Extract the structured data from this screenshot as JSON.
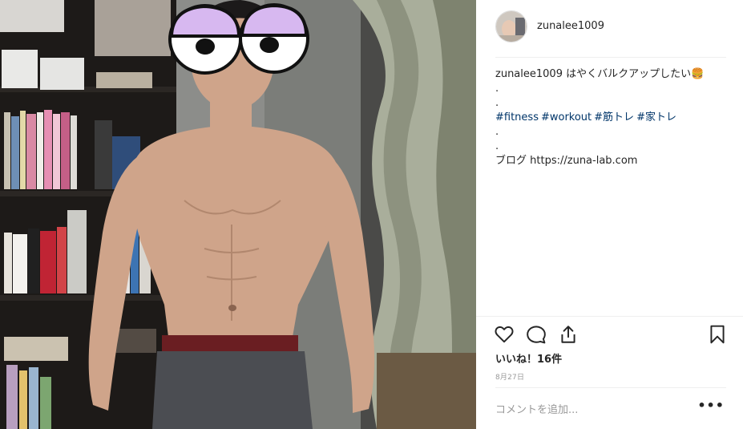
{
  "post": {
    "image_alt": "post-photo",
    "author": "zunalee1009"
  },
  "caption": {
    "username": "zunalee1009",
    "text": " はやくバルクアップしたい🍔",
    "dot1": ".",
    "dot2": ".",
    "hashtags": [
      "#fitness",
      "#workout",
      "#筋トレ",
      "#家トレ"
    ],
    "dot3": ".",
    "dot4": ".",
    "blog_label": "ブログ",
    "blog_url": "https://zuna-lab.com"
  },
  "actions": {
    "like_icon": "heart-icon",
    "comment_icon": "comment-icon",
    "share_icon": "share-icon",
    "save_icon": "bookmark-icon"
  },
  "likes": "いいね！16件",
  "date": "8月27日",
  "comment": {
    "placeholder": "コメントを追加...",
    "more_label": "•••"
  },
  "colors": {
    "text": "#262626",
    "hashtag": "#003569",
    "muted": "#999999",
    "divider": "#efefef"
  }
}
